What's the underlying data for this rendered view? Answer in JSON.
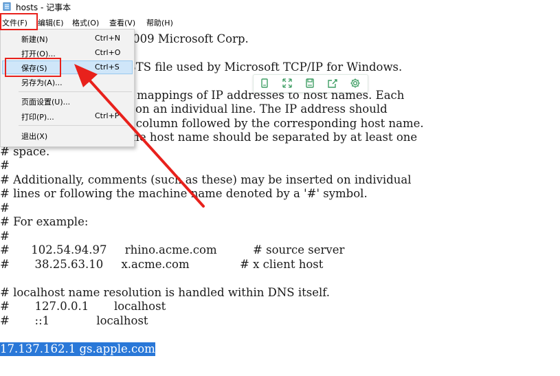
{
  "window": {
    "title": "hosts - 记事本"
  },
  "menubar": {
    "file": "文件(F)",
    "edit": "编辑(E)",
    "format": "格式(O)",
    "view": "查看(V)",
    "help": "帮助(H)"
  },
  "file_menu": {
    "new": {
      "label": "新建(N)",
      "shortcut": "Ctrl+N"
    },
    "open": {
      "label": "打开(O)...",
      "shortcut": "Ctrl+O"
    },
    "save": {
      "label": "保存(S)",
      "shortcut": "Ctrl+S"
    },
    "save_as": {
      "label": "另存为(A)..."
    },
    "page_setup": {
      "label": "页面设置(U)..."
    },
    "print": {
      "label": "打印(P)...",
      "shortcut": "Ctrl+P"
    },
    "exit": {
      "label": "退出(X)"
    }
  },
  "editor": {
    "lines": [
      "# Copyright (c) 1993-2009 Microsoft Corp.",
      "#",
      "# This is a sample HOSTS file used by Microsoft TCP/IP for Windows.",
      "#",
      "# This file contains the mappings of IP addresses to host names. Each",
      "# entry should be kept on an individual line. The IP address should",
      "# be placed in the first column followed by the corresponding host name.",
      "# The IP address and the host name should be separated by at least one",
      "# space.",
      "#",
      "# Additionally, comments (such as these) may be inserted on individual",
      "# lines or following the machine name denoted by a '#' symbol.",
      "#",
      "# For example:",
      "#",
      "#      102.54.94.97     rhino.acme.com          # source server",
      "#       38.25.63.10     x.acme.com              # x client host",
      "",
      "# localhost name resolution is handled within DNS itself.",
      "#       127.0.0.1       localhost",
      "#       ::1             localhost",
      "",
      "17.137.162.1 gs.apple.com"
    ],
    "selected_line_index": 22
  },
  "colors": {
    "annotation_red": "#e8211c",
    "selection_blue": "#2a78d8",
    "menu_highlight": "#cfe6f9",
    "toolbar_icon": "#3f9e64"
  },
  "floating_toolbar": {
    "icons": [
      "copy-icon",
      "expand-icon",
      "save-icon",
      "share-icon",
      "settings-icon"
    ]
  }
}
